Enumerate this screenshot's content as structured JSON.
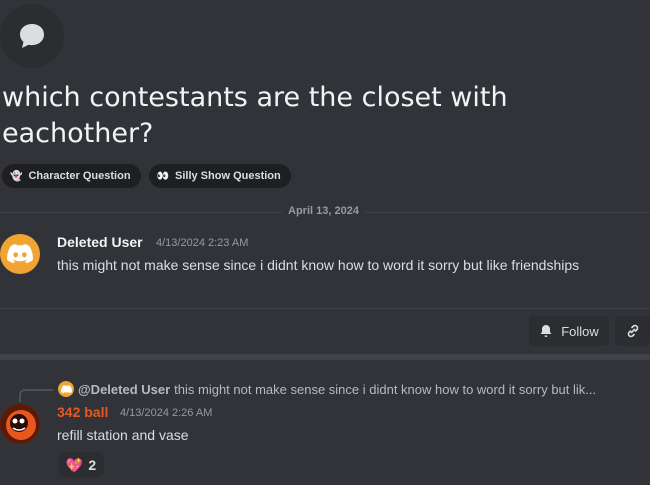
{
  "thread": {
    "title": "which contestants are the closet with eachother?",
    "tags": [
      {
        "emoji": "👻",
        "label": "Character Question"
      },
      {
        "emoji": "👀",
        "label": "Silly Show Question"
      }
    ]
  },
  "date_divider": "April 13, 2024",
  "original_post": {
    "author": "Deleted User",
    "timestamp": "4/13/2024 2:23 AM",
    "text": "this might not make sense since i didnt know how to word it sorry but like friendships"
  },
  "actions": {
    "follow_label": "Follow"
  },
  "reply": {
    "reply_to_author": "@Deleted User",
    "reply_to_preview": "this might not make sense since i didnt know how to word it sorry but lik...",
    "author": "342 ball",
    "author_color": "#e8581e",
    "timestamp": "4/13/2024 2:26 AM",
    "text": "refill station and vase",
    "reaction": {
      "emoji": "💖",
      "count": "2"
    }
  },
  "colors": {
    "background": "#313338",
    "discord_orange": "#f0a432"
  }
}
